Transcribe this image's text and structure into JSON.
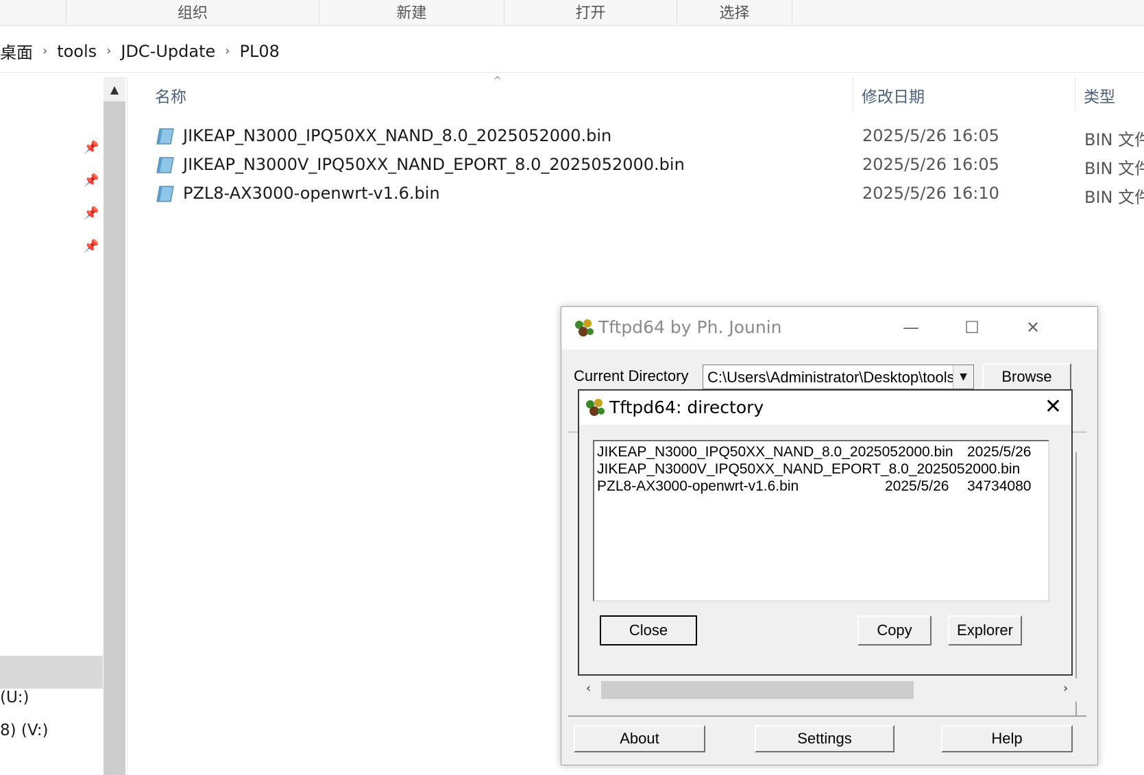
{
  "ribbon": {
    "groups": [
      "组织",
      "新建",
      "打开",
      "选择"
    ]
  },
  "address": {
    "crumbs": [
      "桌面",
      "tools",
      "JDC-Update",
      "PL08"
    ]
  },
  "nav": {
    "drives": [
      "(U:)",
      "8) (V:)"
    ]
  },
  "columns": {
    "name": "名称",
    "modified": "修改日期",
    "type": "类型"
  },
  "files": [
    {
      "name": "JIKEAP_N3000_IPQ50XX_NAND_8.0_2025052000.bin",
      "modified": "2025/5/26 16:05",
      "type": "BIN 文件"
    },
    {
      "name": "JIKEAP_N3000V_IPQ50XX_NAND_EPORT_8.0_2025052000.bin",
      "modified": "2025/5/26 16:05",
      "type": "BIN 文件"
    },
    {
      "name": "PZL8-AX3000-openwrt-v1.6.bin",
      "modified": "2025/5/26 16:10",
      "type": "BIN 文件"
    }
  ],
  "tftpd": {
    "title": "Tftpd64 by Ph. Jounin",
    "current_dir_label": "Current Directory",
    "current_dir_value": "C:\\Users\\Administrator\\Desktop\\tools",
    "browse": "Browse",
    "about": "About",
    "settings": "Settings",
    "help": "Help"
  },
  "dir_dialog": {
    "title": "Tftpd64: directory",
    "entries": [
      {
        "name": "JIKEAP_N3000_IPQ50XX_NAND_8.0_2025052000.bin",
        "date": "2025/5/26",
        "size": ""
      },
      {
        "name": "JIKEAP_N3000V_IPQ50XX_NAND_EPORT_8.0_2025052000.bin",
        "date": "",
        "size": ""
      },
      {
        "name": "PZL8-AX3000-openwrt-v1.6.bin",
        "date": "2025/5/26",
        "size": "34734080"
      }
    ],
    "close": "Close",
    "copy": "Copy",
    "explorer": "Explorer"
  },
  "colors": {
    "header_text": "#4c607a",
    "selected_nav": "#d9d9d9"
  }
}
